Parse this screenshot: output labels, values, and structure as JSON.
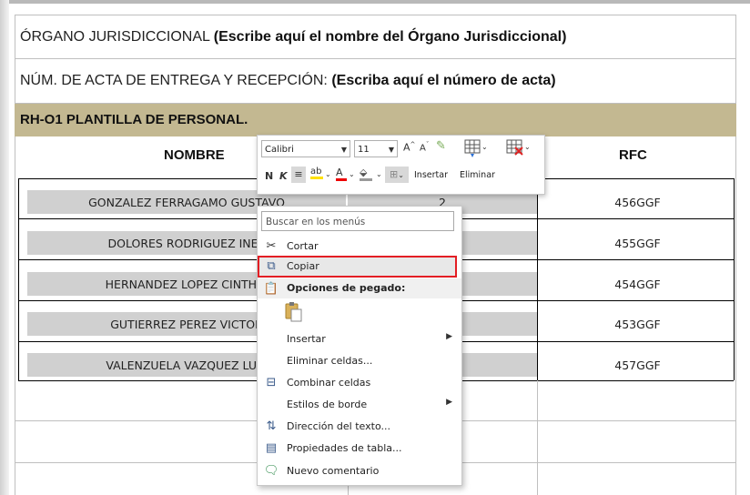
{
  "document": {
    "organo_label": "ÓRGANO JURISDICCIONAL",
    "organo_hint": "(Escribe aquí el nombre del Órgano Jurisdiccional)",
    "acta_label": "NÚM. DE ACTA DE ENTREGA Y RECEPCIÓN:",
    "acta_hint": "(Escriba aquí el número de acta)",
    "section_title": "RH-O1 PLANTILLA DE PERSONAL.",
    "headers": {
      "nombre": "NOMBRE",
      "rfc": "RFC"
    },
    "rows": [
      {
        "name": "GONZALEZ FERRAGAMO GUSTAVO",
        "num": "2",
        "rfc": "456GGF"
      },
      {
        "name": "DOLORES RODRIGUEZ INES",
        "num": "",
        "rfc": "455GGF"
      },
      {
        "name": "HERNANDEZ LOPEZ CINTHIA",
        "num": "",
        "rfc": "454GGF"
      },
      {
        "name": "GUTIERREZ PEREZ VICTOR",
        "num": "",
        "rfc": "453GGF"
      },
      {
        "name": "VALENZUELA VAZQUEZ LUIS",
        "num": "",
        "rfc": "457GGF"
      }
    ]
  },
  "mini_toolbar": {
    "font": "Calibri",
    "size": "11",
    "bold": "N",
    "italic": "K",
    "insert": "Insertar",
    "delete": "Eliminar"
  },
  "context_menu": {
    "search_placeholder": "Buscar en los menús",
    "items": {
      "cut": "Cortar",
      "copy": "Copiar",
      "paste_options": "Opciones de pegado:",
      "insert": "Insertar",
      "delete_cells": "Eliminar celdas...",
      "merge_cells": "Combinar celdas",
      "border_styles": "Estilos de borde",
      "text_direction": "Dirección del texto...",
      "table_properties": "Propiedades de tabla...",
      "new_comment": "Nuevo comentario"
    }
  },
  "colors": {
    "band": "#c3b891",
    "cell_gray": "#d0d0d0",
    "highlight_border": "#e31e24"
  }
}
